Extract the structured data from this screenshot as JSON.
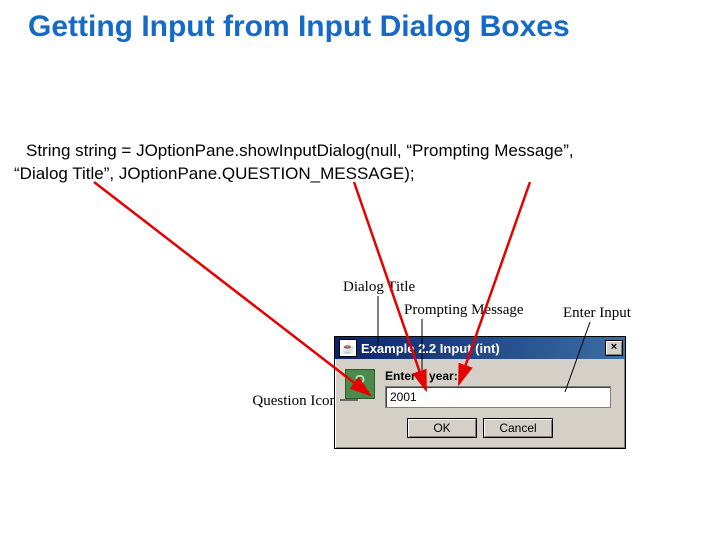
{
  "slide_title": "Getting Input from Input Dialog Boxes",
  "code_line1": "String string = JOptionPane.showInputDialog(null, “Prompting Message”,",
  "code_line2": "“Dialog Title”,  JOptionPane.QUESTION_MESSAGE);",
  "annotations": {
    "dialog_title": "Dialog Title",
    "prompting_message": "Prompting Message",
    "enter_input": "Enter Input",
    "question_icon": "Question Icon"
  },
  "dialog": {
    "titlebar": "Example 2.2 Input (int)",
    "close_glyph": "×",
    "java_glyph": "☕",
    "prompt": "Enter a year:",
    "input_value": "2001",
    "ok": "OK",
    "cancel": "Cancel"
  }
}
